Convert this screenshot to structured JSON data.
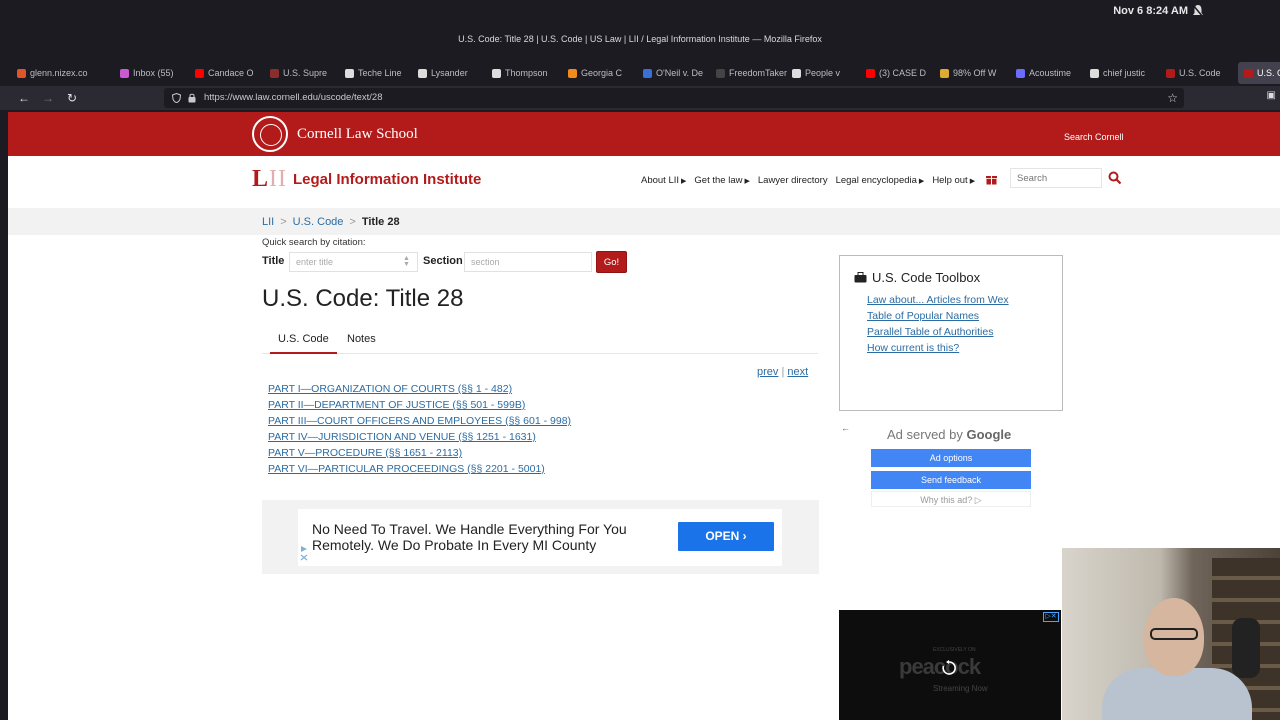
{
  "os": {
    "clock": "Nov 6  8:24 AM"
  },
  "window": {
    "title": "U.S. Code: Title 28 | U.S. Code | US Law | LII / Legal Information Institute — Mozilla Firefox"
  },
  "tabs": [
    {
      "label": "glenn.nizex.co",
      "color": "#e0542a"
    },
    {
      "label": "Inbox (55)",
      "color": "#c95ad1"
    },
    {
      "label": "Candace O",
      "color": "#ff0000"
    },
    {
      "label": "U.S. Supre",
      "color": "#8a2d2d"
    },
    {
      "label": "Teche Line",
      "color": "#dddddd"
    },
    {
      "label": "Lysander",
      "color": "#dddddd"
    },
    {
      "label": "Thompson",
      "color": "#dddddd"
    },
    {
      "label": "Georgia C",
      "color": "#f28a1e"
    },
    {
      "label": "O'Neil v. De",
      "color": "#3b6fd8"
    },
    {
      "label": "FreedomTaker",
      "color": "#444444"
    },
    {
      "label": "People v",
      "color": "#dddddd"
    },
    {
      "label": "(3) CASE D",
      "color": "#ff0000"
    },
    {
      "label": "98% Off W",
      "color": "#ddaa33"
    },
    {
      "label": "Acoustime",
      "color": "#6c6cff"
    },
    {
      "label": "chief justic",
      "color": "#dddddd"
    },
    {
      "label": "U.S. Code",
      "color": "#b31b1b"
    },
    {
      "label": "U.S. Co",
      "color": "#b31b1b"
    }
  ],
  "nav": {
    "url": "https://www.law.cornell.edu/uscode/text/28"
  },
  "cornell": {
    "name": "Cornell Law School",
    "search": "Search Cornell"
  },
  "lii": {
    "mark_l": "L",
    "mark_ii": "II",
    "title": "Legal Information Institute",
    "nav": [
      {
        "label": "About LII",
        "caret": true
      },
      {
        "label": "Get the law",
        "caret": true
      },
      {
        "label": "Lawyer directory",
        "caret": false
      },
      {
        "label": "Legal encyclopedia",
        "caret": true
      },
      {
        "label": "Help out",
        "caret": true
      }
    ],
    "search_placeholder": "Search"
  },
  "breadcrumb": {
    "home": "LII",
    "section": "U.S. Code",
    "current": "Title 28",
    "separator": ">"
  },
  "quick_search": {
    "label": "Quick search by citation:",
    "title_label": "Title",
    "title_placeholder": "enter title",
    "section_label": "Section",
    "section_placeholder": "section",
    "go": "Go!"
  },
  "page_title": "U.S. Code: Title 28",
  "page_tabs": {
    "uscode": "U.S. Code",
    "notes": "Notes"
  },
  "pager": {
    "prev": "prev",
    "sep": "|",
    "next": "next"
  },
  "parts": [
    "PART I—ORGANIZATION OF COURTS (§§ 1 - 482)",
    "PART II—DEPARTMENT OF JUSTICE (§§ 501 - 599B)",
    "PART III—COURT OFFICERS AND EMPLOYEES (§§ 601 - 998)",
    "PART IV—JURISDICTION AND VENUE (§§ 1251 - 1631)",
    "PART V—PROCEDURE (§§ 1651 - 2113)",
    "PART VI—PARTICULAR PROCEEDINGS (§§ 2201 - 5001)"
  ],
  "ad_banner": {
    "text": "No Need To Travel. We Handle Everything For You Remotely. We Do Probate In Every MI County",
    "button": "OPEN"
  },
  "toolbox": {
    "title": "U.S. Code Toolbox",
    "links": [
      "Law about... Articles from Wex",
      "Table of Popular Names",
      "Parallel Table of Authorities",
      "How current is this?"
    ]
  },
  "google_ad": {
    "served_prefix": "Ad served by",
    "served_brand": "Google",
    "options": "Ad options",
    "feedback": "Send feedback",
    "why": "Why this ad? ▷"
  },
  "video_ad": {
    "exclusive": "EXCLUSIVELY ON",
    "brand": "peacock",
    "sub": "Streaming Now"
  },
  "colors": {
    "cornell_red": "#b31b1b",
    "link_blue": "#2b6ca3",
    "google_blue": "#4285f4"
  }
}
